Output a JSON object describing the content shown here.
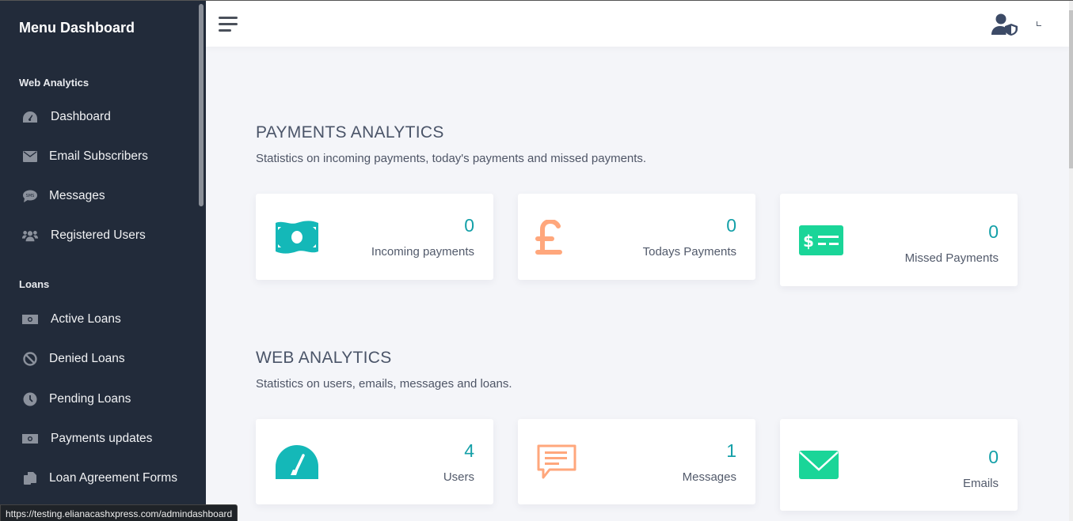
{
  "sidebar": {
    "brand": "Menu Dashboard",
    "sections": [
      {
        "title": "Web Analytics",
        "items": [
          {
            "label": "Dashboard",
            "icon": "gauge-icon"
          },
          {
            "label": "Email Subscribers",
            "icon": "envelope-icon"
          },
          {
            "label": "Messages",
            "icon": "sms-bubble-icon"
          },
          {
            "label": "Registered Users",
            "icon": "users-icon"
          }
        ]
      },
      {
        "title": "Loans",
        "items": [
          {
            "label": "Active Loans",
            "icon": "money-bill-icon"
          },
          {
            "label": "Denied Loans",
            "icon": "ban-icon"
          },
          {
            "label": "Pending Loans",
            "icon": "clock-icon"
          },
          {
            "label": "Payments updates",
            "icon": "money-bill-icon"
          },
          {
            "label": "Loan Agreement Forms",
            "icon": "copy-icon"
          }
        ]
      }
    ]
  },
  "topbar": {
    "menu_icon": "hamburger-icon",
    "user_icon": "user-shield-icon"
  },
  "payments": {
    "title": "PAYMENTS ANALYTICS",
    "description": "Statistics on incoming payments, today's payments and missed payments.",
    "cards": [
      {
        "value": "0",
        "label": "Incoming payments",
        "icon": "money-bill-wave-icon",
        "color": "#14b8b8"
      },
      {
        "value": "0",
        "label": "Todays Payments",
        "icon": "pound-sign-icon",
        "color": "#ffa77c"
      },
      {
        "value": "0",
        "label": "Missed Payments",
        "icon": "money-check-icon",
        "color": "#1ad598"
      }
    ]
  },
  "web": {
    "title": "WEB ANALYTICS",
    "description": "Statistics on users, emails, messages and loans.",
    "cards": [
      {
        "value": "4",
        "label": "Users",
        "icon": "gauge-icon",
        "color": "#14b8b8"
      },
      {
        "value": "1",
        "label": "Messages",
        "icon": "comment-alt-icon",
        "color": "#ffa77c"
      },
      {
        "value": "0",
        "label": "Emails",
        "icon": "envelope-icon",
        "color": "#1ad598"
      }
    ]
  },
  "status_bar": {
    "url": "https://testing.elianacashxpress.com/admindashboard"
  }
}
